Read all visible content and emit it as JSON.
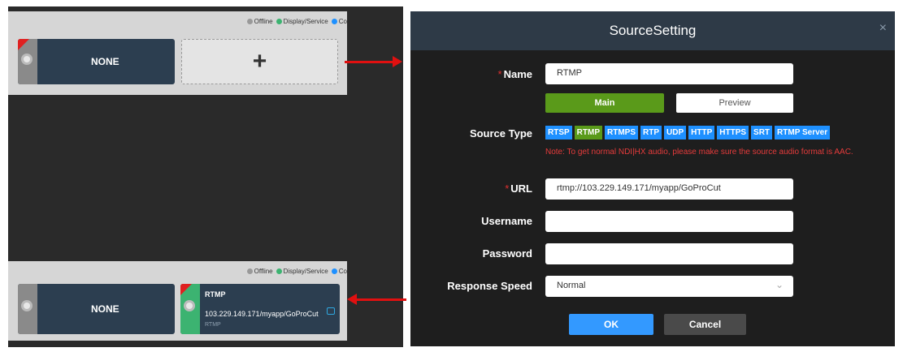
{
  "legend": {
    "offline": "Offline",
    "display_service": "Display/Service",
    "connecting": "Co",
    "colors": {
      "offline": "#999999",
      "display_service": "#3cb371",
      "connecting": "#1e90ff"
    }
  },
  "top_panel": {
    "card_title": "NONE",
    "add_symbol": "+"
  },
  "bottom_panel": {
    "card_left_title": "NONE",
    "card_right": {
      "title": "RTMP",
      "url": "103.229.149.171/myapp/GoProCut",
      "type": "RTMP"
    }
  },
  "dialog": {
    "title": "SourceSetting",
    "close": "×",
    "name_label": "Name",
    "name_value": "RTMP",
    "main_button": "Main",
    "preview_button": "Preview",
    "source_type_label": "Source Type",
    "source_types": [
      "RTSP",
      "RTMP",
      "RTMPS",
      "RTP",
      "UDP",
      "HTTP",
      "HTTPS",
      "SRT",
      "RTMP Server"
    ],
    "active_type": "RTMP",
    "note": "Note: To get normal NDI|HX audio, please make sure the source audio format is AAC.",
    "url_label": "URL",
    "url_value": "rtmp://103.229.149.171/myapp/GoProCut",
    "username_label": "Username",
    "username_value": "",
    "password_label": "Password",
    "password_value": "",
    "response_speed_label": "Response Speed",
    "response_speed_value": "Normal",
    "ok_button": "OK",
    "cancel_button": "Cancel",
    "required_mark": "*"
  }
}
